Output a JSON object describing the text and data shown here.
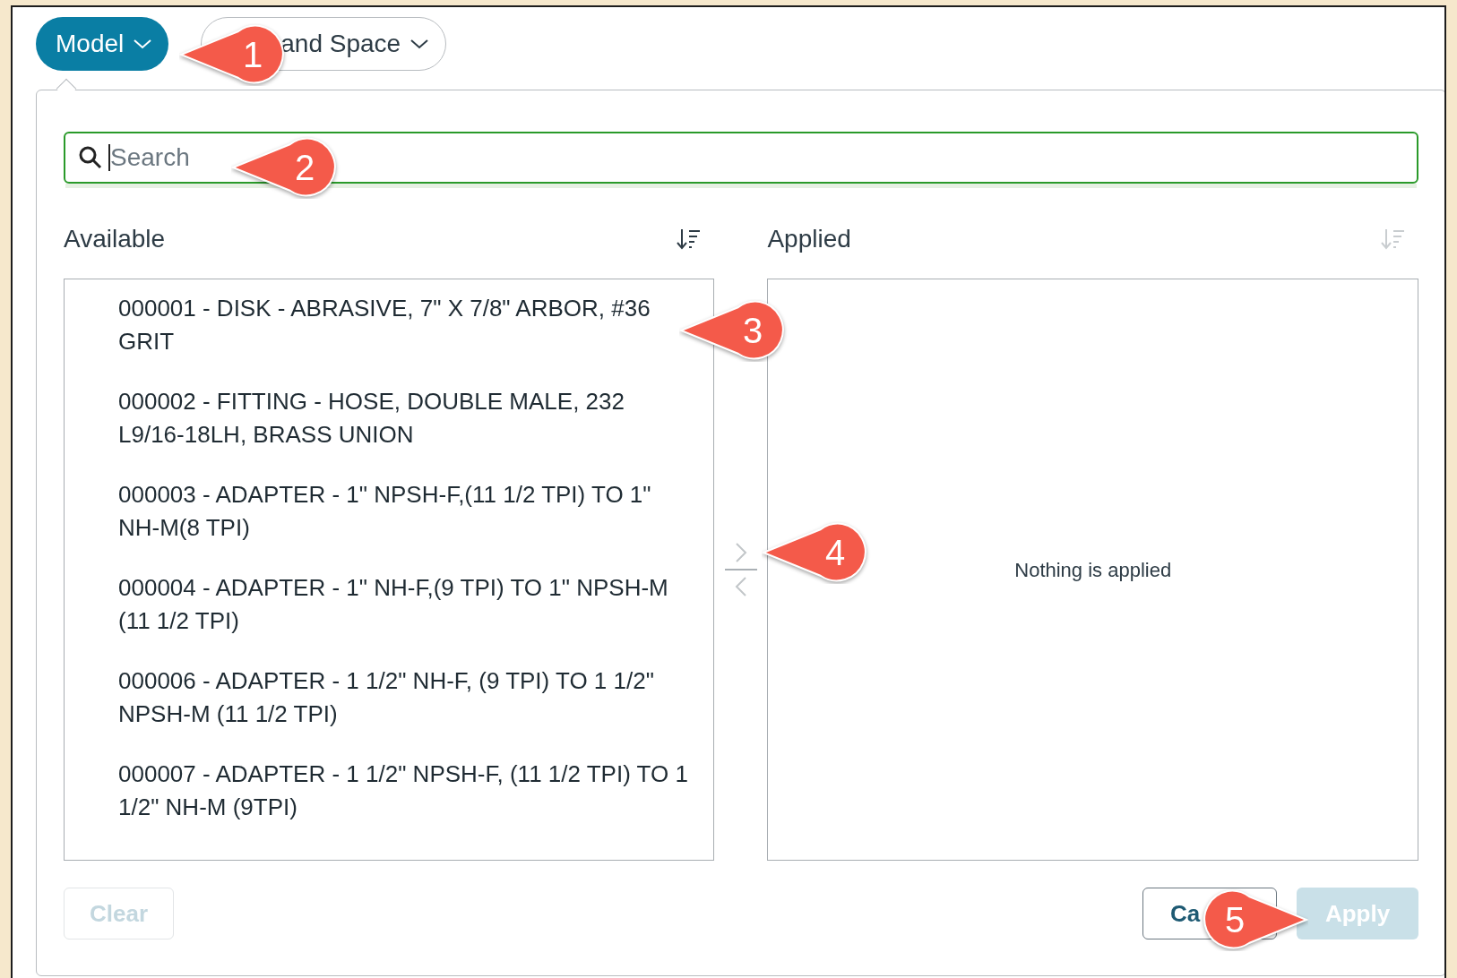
{
  "filter_chips": [
    {
      "label": "Model",
      "selected": true
    },
    {
      "label": "and Space",
      "selected": false
    }
  ],
  "search": {
    "placeholder": "Search"
  },
  "available": {
    "title": "Available",
    "items": [
      {
        "label": "000001 - DISK - ABRASIVE, 7\" X 7/8\" ARBOR, #36 GRIT"
      },
      {
        "label": "000002 - FITTING - HOSE, DOUBLE MALE, 232 L9/16-18LH, BRASS UNION"
      },
      {
        "label": "000003 - ADAPTER - 1\" NPSH-F,(11 1/2 TPI) TO 1\" NH-M(8 TPI)"
      },
      {
        "label": "000004 - ADAPTER - 1\" NH-F,(9 TPI) TO 1\" NPSH-M (11 1/2 TPI)"
      },
      {
        "label": "000006 - ADAPTER - 1 1/2\" NH-F, (9 TPI) TO 1 1/2\" NPSH-M (11 1/2 TPI)"
      },
      {
        "label": "000007 - ADAPTER - 1 1/2\" NPSH-F, (11 1/2 TPI) TO 1 1/2\" NH-M (9TPI)"
      }
    ]
  },
  "applied": {
    "title": "Applied",
    "empty_message": "Nothing is applied"
  },
  "buttons": [
    {
      "label": "Clear",
      "disabled": true
    },
    {
      "label": "Ca",
      "disabled": false
    },
    {
      "label": "Apply",
      "disabled": true
    }
  ],
  "callouts": [
    {
      "number": "1"
    },
    {
      "number": "2"
    },
    {
      "number": "3"
    },
    {
      "number": "4"
    },
    {
      "number": "5"
    }
  ]
}
